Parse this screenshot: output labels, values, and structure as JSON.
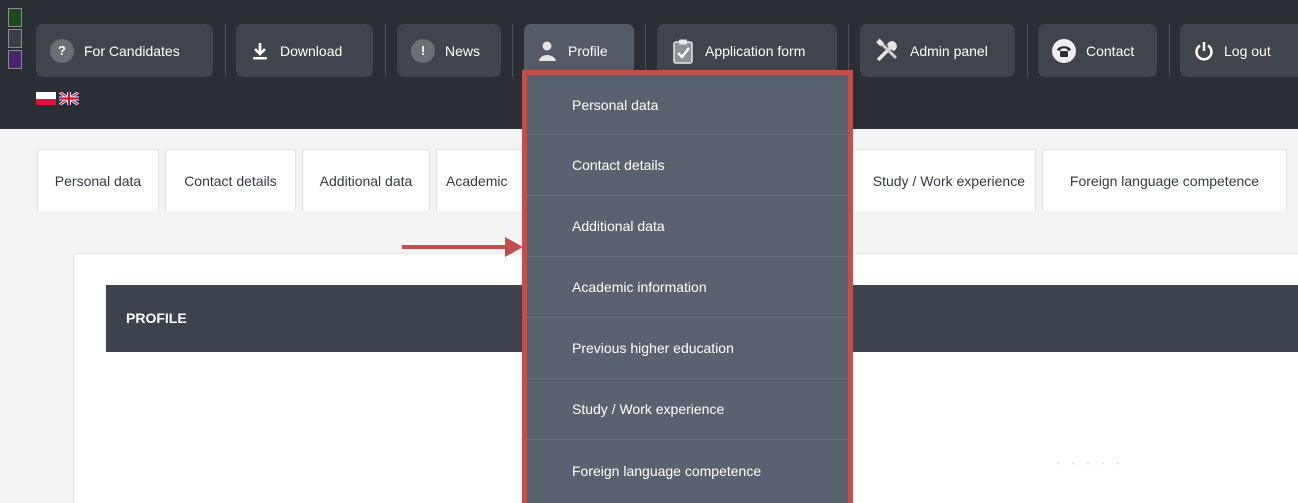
{
  "nav": {
    "items": [
      {
        "label": "For Candidates",
        "icon": "question-icon"
      },
      {
        "label": "Download",
        "icon": "download-icon"
      },
      {
        "label": "News",
        "icon": "exclamation-icon"
      },
      {
        "label": "Profile",
        "icon": "user-icon"
      },
      {
        "label": "Application form",
        "icon": "clipboard-icon"
      },
      {
        "label": "Admin panel",
        "icon": "tools-icon"
      },
      {
        "label": "Contact",
        "icon": "phone-icon"
      },
      {
        "label": "Log out",
        "icon": "power-icon"
      }
    ],
    "active": "Profile",
    "languages": [
      "pl-flag-icon",
      "uk-flag-icon"
    ]
  },
  "tabs": {
    "items": [
      "Personal data",
      "Contact details",
      "Additional data",
      "Academic",
      "Study / Work experience",
      "Foreign language competence"
    ]
  },
  "profile_dropdown": {
    "items": [
      "Personal data",
      "Contact details",
      "Additional data",
      "Academic information",
      "Previous higher education",
      "Study / Work experience",
      "Foreign language competence"
    ]
  },
  "main": {
    "section_title": "PROFILE"
  },
  "colors": {
    "topbar": "#2a2e35",
    "nav_button": "#40454d",
    "dropdown_bg": "#5a6270",
    "highlight_border": "#c0504d",
    "profile_bar": "#3d434d"
  }
}
